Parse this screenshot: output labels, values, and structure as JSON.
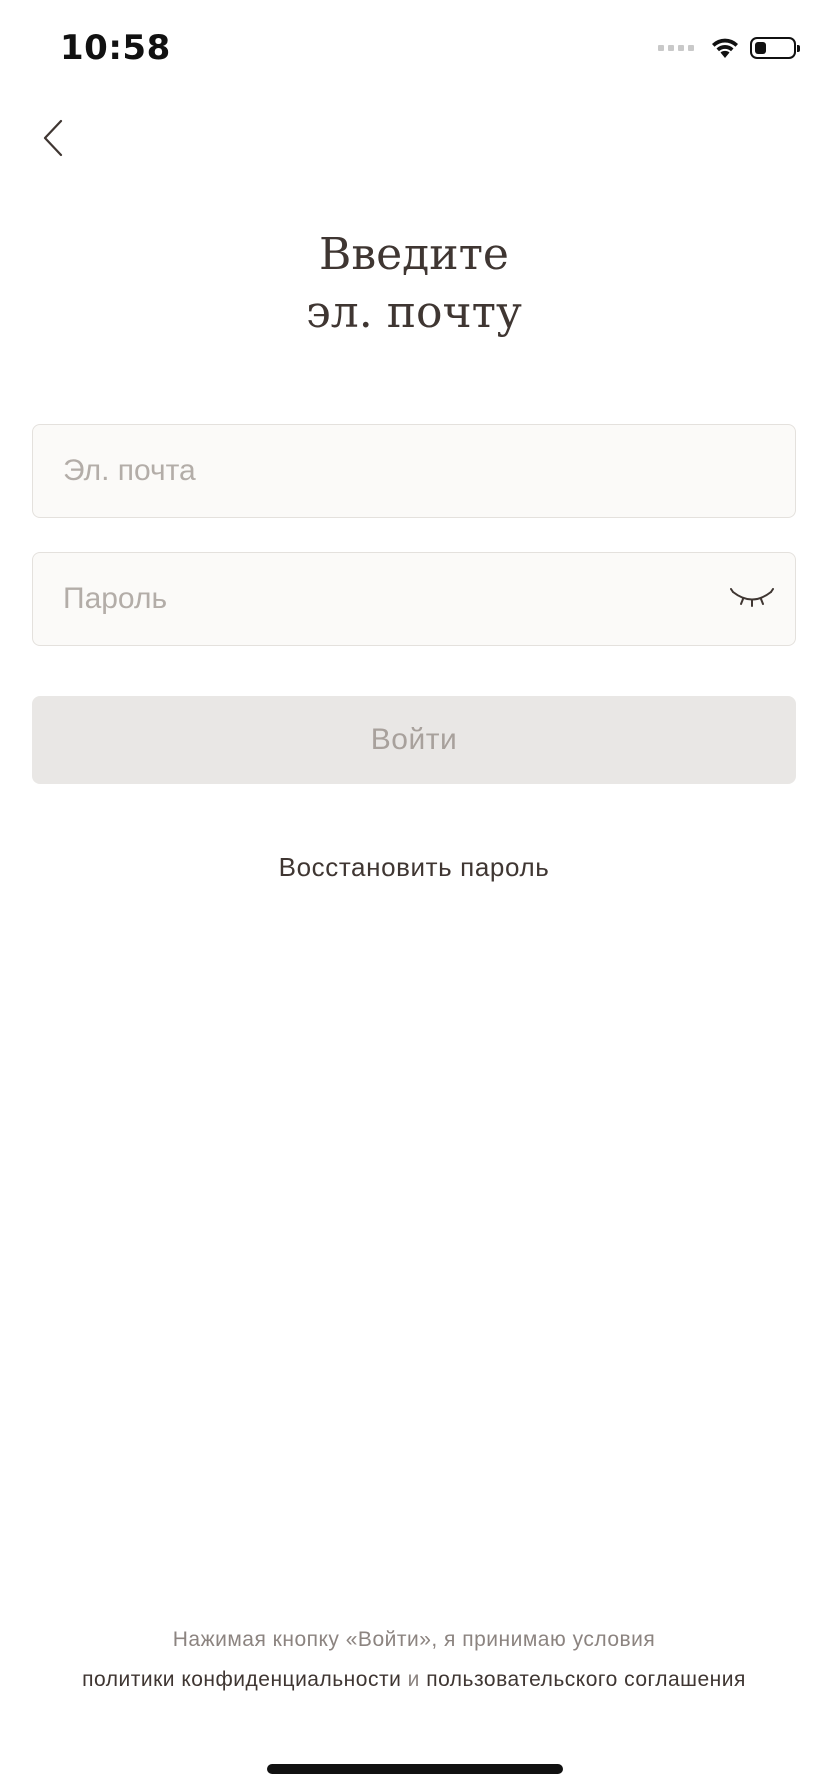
{
  "status_bar": {
    "time": "10:58",
    "icons": [
      "signal-icon",
      "wifi-icon",
      "battery-icon"
    ],
    "battery_level": 0.3
  },
  "header": {
    "back_icon": "chevron-left-icon"
  },
  "title": "Введите\nэл. почту",
  "form": {
    "email_placeholder": "Эл. почта",
    "email_value": "",
    "password_placeholder": "Пароль",
    "password_value": "",
    "password_toggle_icon": "eye-closed-icon",
    "login_label": "Войти"
  },
  "restore_password_label": "Восстановить пароль",
  "terms": {
    "line1": "Нажимая кнопку «Войти», я принимаю условия",
    "privacy_link": "политики конфиденциальности",
    "conjunction": " и ",
    "agreement_link": "пользовательского соглашения"
  },
  "colors": {
    "text": "#3f3632",
    "muted": "#8c8480",
    "placeholder": "#b3ada8",
    "field_bg": "#fbfaf8",
    "field_border": "#e4e1dd",
    "button_disabled_bg": "#e9e7e5",
    "button_disabled_text": "#a8a19c"
  }
}
